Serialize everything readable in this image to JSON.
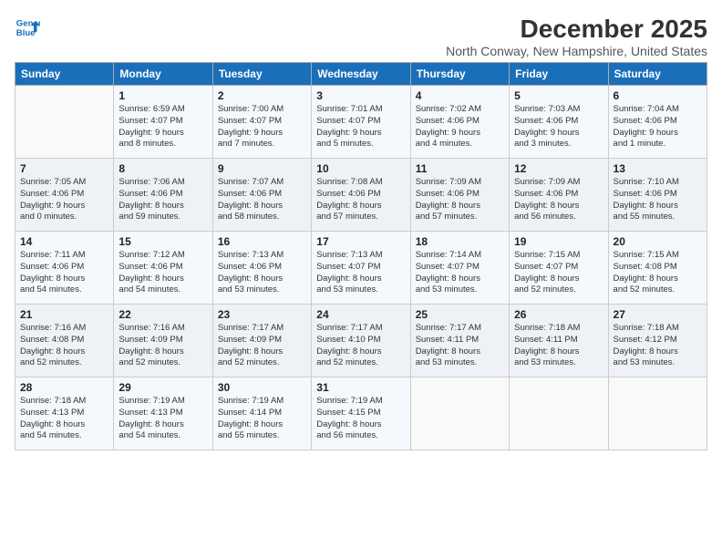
{
  "logo": {
    "line1": "General",
    "line2": "Blue"
  },
  "title": "December 2025",
  "location": "North Conway, New Hampshire, United States",
  "days_of_week": [
    "Sunday",
    "Monday",
    "Tuesday",
    "Wednesday",
    "Thursday",
    "Friday",
    "Saturday"
  ],
  "weeks": [
    [
      {
        "day": "",
        "info": ""
      },
      {
        "day": "1",
        "info": "Sunrise: 6:59 AM\nSunset: 4:07 PM\nDaylight: 9 hours\nand 8 minutes."
      },
      {
        "day": "2",
        "info": "Sunrise: 7:00 AM\nSunset: 4:07 PM\nDaylight: 9 hours\nand 7 minutes."
      },
      {
        "day": "3",
        "info": "Sunrise: 7:01 AM\nSunset: 4:07 PM\nDaylight: 9 hours\nand 5 minutes."
      },
      {
        "day": "4",
        "info": "Sunrise: 7:02 AM\nSunset: 4:06 PM\nDaylight: 9 hours\nand 4 minutes."
      },
      {
        "day": "5",
        "info": "Sunrise: 7:03 AM\nSunset: 4:06 PM\nDaylight: 9 hours\nand 3 minutes."
      },
      {
        "day": "6",
        "info": "Sunrise: 7:04 AM\nSunset: 4:06 PM\nDaylight: 9 hours\nand 1 minute."
      }
    ],
    [
      {
        "day": "7",
        "info": "Sunrise: 7:05 AM\nSunset: 4:06 PM\nDaylight: 9 hours\nand 0 minutes."
      },
      {
        "day": "8",
        "info": "Sunrise: 7:06 AM\nSunset: 4:06 PM\nDaylight: 8 hours\nand 59 minutes."
      },
      {
        "day": "9",
        "info": "Sunrise: 7:07 AM\nSunset: 4:06 PM\nDaylight: 8 hours\nand 58 minutes."
      },
      {
        "day": "10",
        "info": "Sunrise: 7:08 AM\nSunset: 4:06 PM\nDaylight: 8 hours\nand 57 minutes."
      },
      {
        "day": "11",
        "info": "Sunrise: 7:09 AM\nSunset: 4:06 PM\nDaylight: 8 hours\nand 57 minutes."
      },
      {
        "day": "12",
        "info": "Sunrise: 7:09 AM\nSunset: 4:06 PM\nDaylight: 8 hours\nand 56 minutes."
      },
      {
        "day": "13",
        "info": "Sunrise: 7:10 AM\nSunset: 4:06 PM\nDaylight: 8 hours\nand 55 minutes."
      }
    ],
    [
      {
        "day": "14",
        "info": "Sunrise: 7:11 AM\nSunset: 4:06 PM\nDaylight: 8 hours\nand 54 minutes."
      },
      {
        "day": "15",
        "info": "Sunrise: 7:12 AM\nSunset: 4:06 PM\nDaylight: 8 hours\nand 54 minutes."
      },
      {
        "day": "16",
        "info": "Sunrise: 7:13 AM\nSunset: 4:06 PM\nDaylight: 8 hours\nand 53 minutes."
      },
      {
        "day": "17",
        "info": "Sunrise: 7:13 AM\nSunset: 4:07 PM\nDaylight: 8 hours\nand 53 minutes."
      },
      {
        "day": "18",
        "info": "Sunrise: 7:14 AM\nSunset: 4:07 PM\nDaylight: 8 hours\nand 53 minutes."
      },
      {
        "day": "19",
        "info": "Sunrise: 7:15 AM\nSunset: 4:07 PM\nDaylight: 8 hours\nand 52 minutes."
      },
      {
        "day": "20",
        "info": "Sunrise: 7:15 AM\nSunset: 4:08 PM\nDaylight: 8 hours\nand 52 minutes."
      }
    ],
    [
      {
        "day": "21",
        "info": "Sunrise: 7:16 AM\nSunset: 4:08 PM\nDaylight: 8 hours\nand 52 minutes."
      },
      {
        "day": "22",
        "info": "Sunrise: 7:16 AM\nSunset: 4:09 PM\nDaylight: 8 hours\nand 52 minutes."
      },
      {
        "day": "23",
        "info": "Sunrise: 7:17 AM\nSunset: 4:09 PM\nDaylight: 8 hours\nand 52 minutes."
      },
      {
        "day": "24",
        "info": "Sunrise: 7:17 AM\nSunset: 4:10 PM\nDaylight: 8 hours\nand 52 minutes."
      },
      {
        "day": "25",
        "info": "Sunrise: 7:17 AM\nSunset: 4:11 PM\nDaylight: 8 hours\nand 53 minutes."
      },
      {
        "day": "26",
        "info": "Sunrise: 7:18 AM\nSunset: 4:11 PM\nDaylight: 8 hours\nand 53 minutes."
      },
      {
        "day": "27",
        "info": "Sunrise: 7:18 AM\nSunset: 4:12 PM\nDaylight: 8 hours\nand 53 minutes."
      }
    ],
    [
      {
        "day": "28",
        "info": "Sunrise: 7:18 AM\nSunset: 4:13 PM\nDaylight: 8 hours\nand 54 minutes."
      },
      {
        "day": "29",
        "info": "Sunrise: 7:19 AM\nSunset: 4:13 PM\nDaylight: 8 hours\nand 54 minutes."
      },
      {
        "day": "30",
        "info": "Sunrise: 7:19 AM\nSunset: 4:14 PM\nDaylight: 8 hours\nand 55 minutes."
      },
      {
        "day": "31",
        "info": "Sunrise: 7:19 AM\nSunset: 4:15 PM\nDaylight: 8 hours\nand 56 minutes."
      },
      {
        "day": "",
        "info": ""
      },
      {
        "day": "",
        "info": ""
      },
      {
        "day": "",
        "info": ""
      }
    ]
  ]
}
